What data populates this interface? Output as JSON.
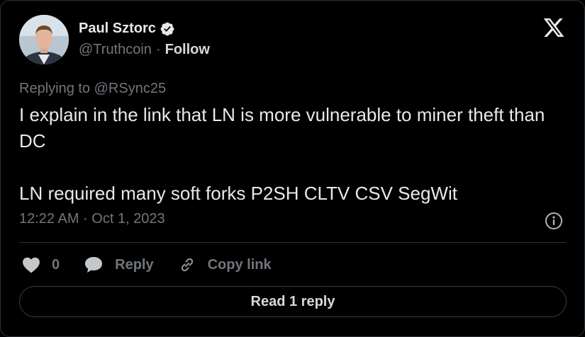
{
  "author": {
    "name": "Paul Sztorc",
    "handle": "@Truthcoin",
    "separator": "·",
    "follow_label": "Follow"
  },
  "tweet": {
    "replying_prefix": "Replying to",
    "replying_to": "@RSync25",
    "text": "I explain in the link that LN is more vulnerable to miner theft than DC\n\nLN required many soft forks P2SH CLTV CSV SegWit",
    "timestamp": "12:22 AM · Oct 1, 2023"
  },
  "actions": {
    "like_count": "0",
    "reply_label": "Reply",
    "copy_label": "Copy link"
  },
  "read_reply_label": "Read 1 reply",
  "colors": {
    "background": "#000000",
    "text": "#e7e9ea",
    "muted": "#71767b",
    "border": "#2f3336"
  },
  "icons": [
    "verified-badge-icon",
    "x-logo-icon",
    "info-icon",
    "heart-icon",
    "reply-bubble-icon",
    "link-icon"
  ]
}
